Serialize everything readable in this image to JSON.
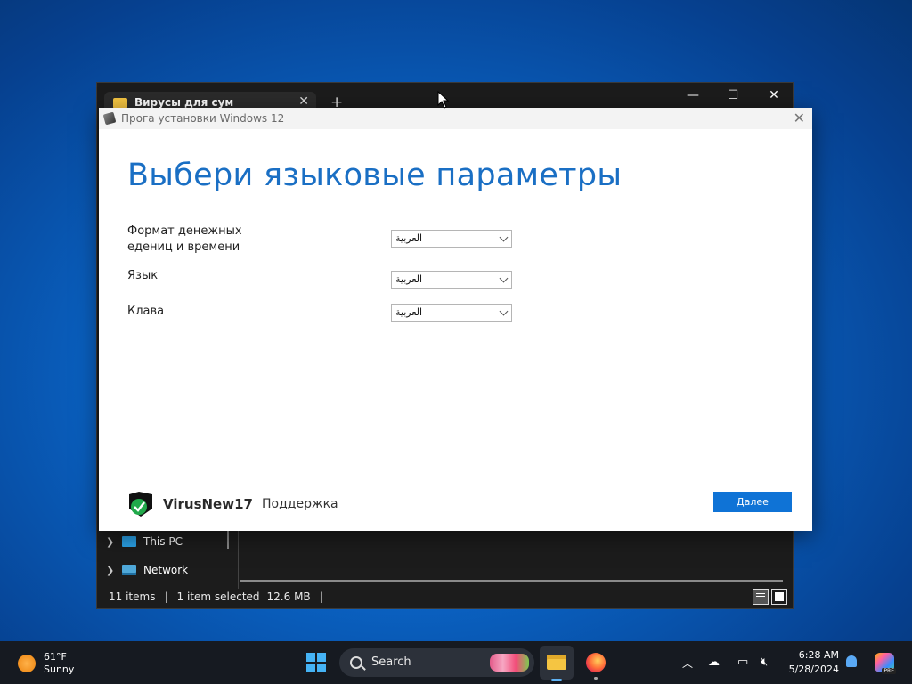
{
  "explorer": {
    "tab_title": "Вирусы для сум",
    "nav": [
      {
        "label": "This PC"
      },
      {
        "label": "Network"
      }
    ],
    "status": {
      "items": "11 items",
      "selected": "1 item selected",
      "size": "12.6 MB"
    }
  },
  "setup": {
    "window_title": "Прога установки Windows 12",
    "heading": "Выбери языковые параметры",
    "fields": [
      {
        "label_line1": "Формат денежных",
        "label_line2": "едениц и времени",
        "value": "العربية"
      },
      {
        "label": "Язык",
        "value": "العربية"
      },
      {
        "label": "Клава",
        "value": "العربية"
      }
    ],
    "brand": "VirusNew17",
    "support": "Поддержка",
    "next": "Далее",
    "colors": {
      "heading": "#1a6fc4",
      "button": "#0f73d6"
    }
  },
  "taskbar": {
    "weather": {
      "temp": "61°F",
      "condition": "Sunny"
    },
    "search_label": "Search",
    "time": "6:28 AM",
    "date": "5/28/2024",
    "copilot_badge": "PRE"
  }
}
